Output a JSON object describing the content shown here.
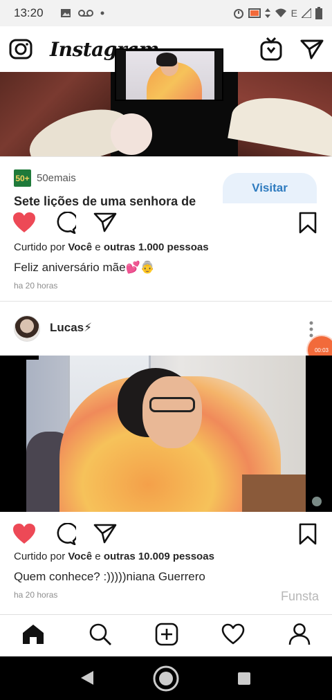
{
  "status_bar": {
    "time": "13:20",
    "network_label": "E"
  },
  "app": {
    "logo": "Instagram"
  },
  "ad": {
    "brand_logo_text": "50+",
    "brand_name": "50emais",
    "title": "Sete lições de uma senhora de",
    "cta_label": "Visitar"
  },
  "post1": {
    "likes_prefix": "Curtido por ",
    "likes_user": "Você",
    "likes_mid": " e ",
    "likes_count": "outras 1.000 pessoas",
    "caption": "Feliz aniversário mãe💕👵",
    "time_ago": "ha 20 horas"
  },
  "post2": {
    "username": "Lucas⚡",
    "recording_timer": "00:03",
    "likes_prefix": "Curtido por ",
    "likes_user": "Você",
    "likes_mid": " e ",
    "likes_count": "outras 10.009 pessoas",
    "caption": "Quem conhece? :)))))niana Guerrero",
    "time_ago": "ha 20 horas"
  },
  "watermark": "Funsta",
  "icons": {
    "camera": "camera-icon",
    "igtv": "igtv-icon",
    "direct": "direct-message-icon",
    "like": "heart-filled-icon",
    "comment": "comment-icon",
    "share": "share-icon",
    "save": "bookmark-icon",
    "nav_home": "home-icon",
    "nav_search": "search-icon",
    "nav_add": "add-post-icon",
    "nav_activity": "heart-outline-icon",
    "nav_profile": "profile-icon"
  },
  "colors": {
    "like_red": "#ed4956",
    "cta_bg": "#e8f1fb",
    "cta_text": "#2e7bbf",
    "recording": "#f26a3a"
  }
}
